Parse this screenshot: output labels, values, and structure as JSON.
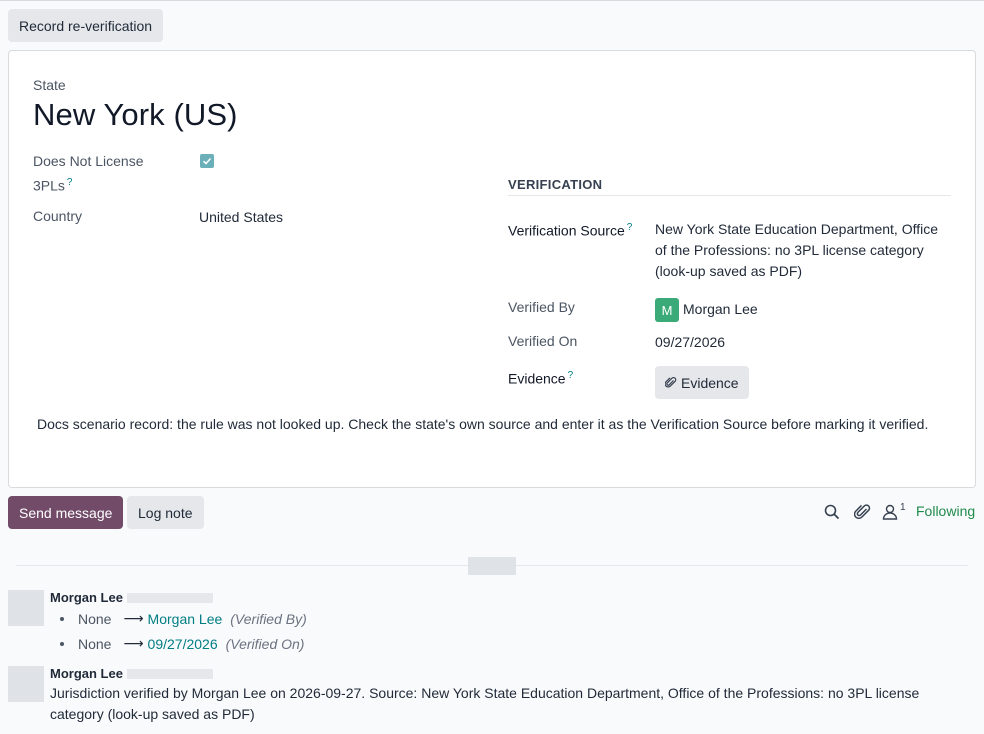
{
  "header": {
    "reverify_label": "Record re-verification"
  },
  "record": {
    "state_label": "State",
    "state_name": "New York (US)",
    "no_license_label_1": "Does Not License",
    "no_license_label_2": "3PLs",
    "no_license_checked": true,
    "country_label": "Country",
    "country_value": "United States"
  },
  "verification": {
    "section_title": "VERIFICATION",
    "source_label": "Verification Source",
    "source_line1": "New York State Education Department, Office",
    "source_line2": "of the Professions: no 3PL license category",
    "source_line3": "(look-up saved as PDF)",
    "verified_by_label": "Verified By",
    "verified_by_initial": "M",
    "verified_by_value": "Morgan Lee",
    "verified_on_label": "Verified On",
    "verified_on_value": "09/27/2026",
    "evidence_label": "Evidence",
    "evidence_button": "Evidence"
  },
  "note": "Docs scenario record: the rule was not looked up. Check the state's own source and enter it as the Verification Source before marking it verified.",
  "chatter": {
    "send_label": "Send message",
    "log_label": "Log note",
    "follower_count": "1",
    "following_label": "Following",
    "help_mark": "?",
    "messages": [
      {
        "author": "Morgan Lee",
        "changes": [
          {
            "old": "None",
            "new": "Morgan Lee",
            "field": "(Verified By)"
          },
          {
            "old": "None",
            "new": "09/27/2026",
            "field": "(Verified On)"
          }
        ]
      },
      {
        "author": "Morgan Lee",
        "body_line1": "Jurisdiction verified by Morgan Lee on 2026-09-27. Source: New York State Education Department, Office of the Professions: no 3PL license",
        "body_line2": "category (look-up saved as PDF)"
      }
    ]
  },
  "colors": {
    "brand": "#714b67",
    "link": "#017e84",
    "following": "#1f8a4c",
    "avatar": "#3aaa78"
  }
}
